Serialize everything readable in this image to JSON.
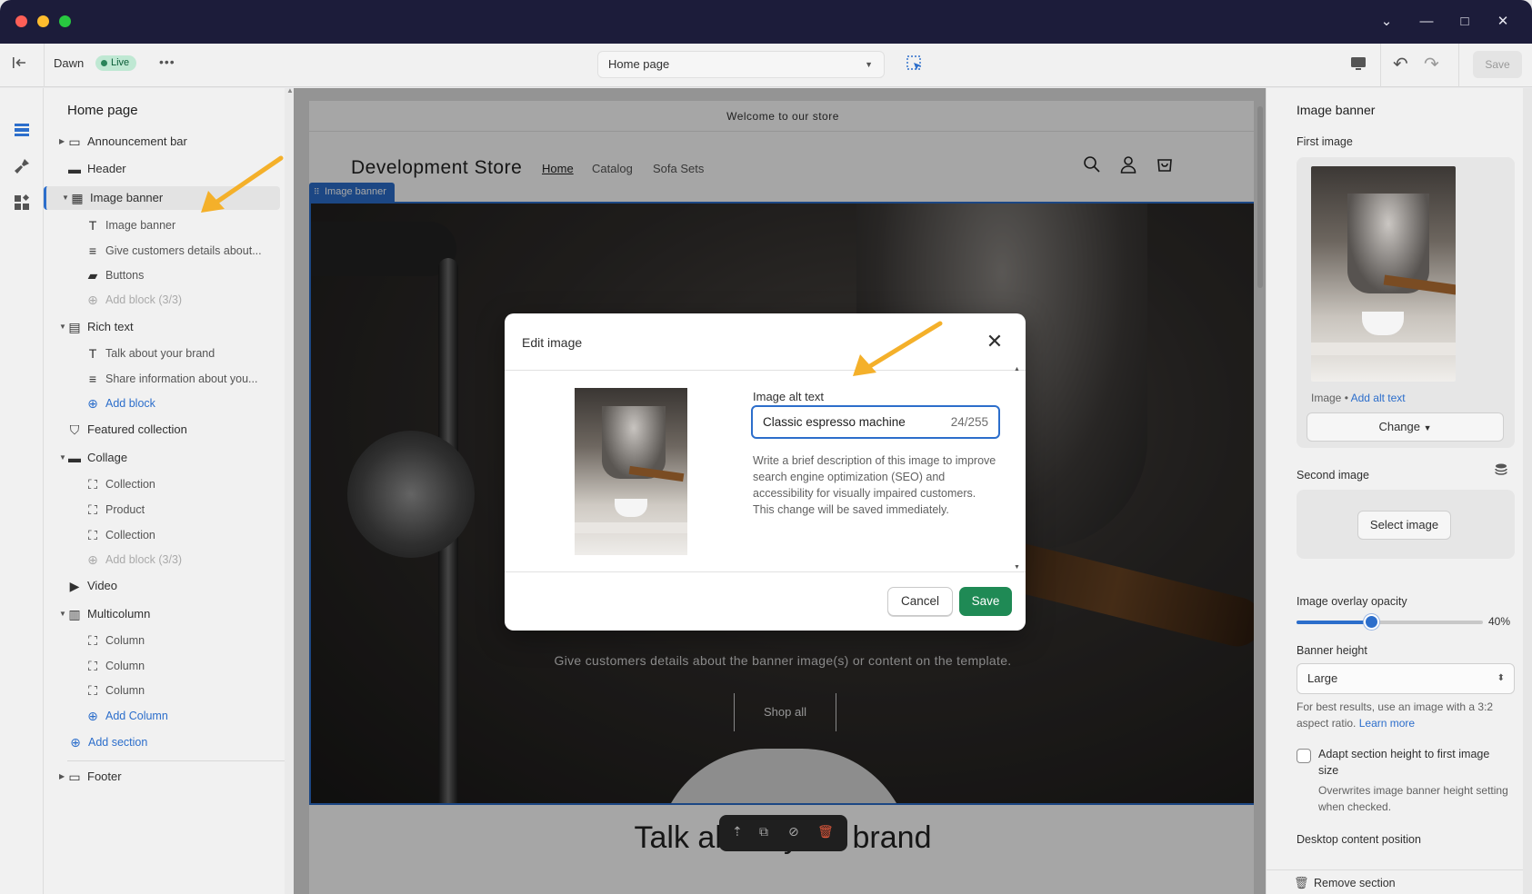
{
  "titlebar": {
    "controls": [
      "⌄",
      "—",
      "□",
      "✕"
    ]
  },
  "toolbar": {
    "theme_name": "Dawn",
    "live_badge": "Live",
    "more": "•••",
    "page_select": "Home page",
    "save_label": "Save"
  },
  "sidebar": {
    "title": "Home page",
    "items": [
      {
        "label": "Announcement bar",
        "icon": "layout-icon",
        "glyph": "▭",
        "level": 0,
        "toggle": "▶"
      },
      {
        "label": "Header",
        "icon": "layout-icon",
        "glyph": "▬",
        "level": 0,
        "toggle": ""
      },
      {
        "label": "Image banner",
        "icon": "image-icon",
        "glyph": "▦",
        "level": 0,
        "toggle": "▼",
        "active": true
      },
      {
        "label": "Image banner",
        "icon": "text-icon",
        "glyph": "T",
        "level": 1
      },
      {
        "label": "Give customers details about...",
        "icon": "paragraph-icon",
        "glyph": "≡",
        "level": 1
      },
      {
        "label": "Buttons",
        "icon": "button-icon",
        "glyph": "▰",
        "level": 1
      },
      {
        "label": "Add block (3/3)",
        "icon": "plus-circle-icon",
        "glyph": "⊕",
        "level": 1,
        "kind": "disabled"
      },
      {
        "label": "Rich text",
        "icon": "paragraph-icon",
        "glyph": "▤",
        "level": 0,
        "toggle": "▼"
      },
      {
        "label": "Talk about your brand",
        "icon": "text-icon",
        "glyph": "T",
        "level": 1
      },
      {
        "label": "Share information about you...",
        "icon": "paragraph-icon",
        "glyph": "≡",
        "level": 1
      },
      {
        "label": "Add block",
        "icon": "plus-circle-icon",
        "glyph": "⊕",
        "level": 1,
        "kind": "add"
      },
      {
        "label": "Featured collection",
        "icon": "tag-icon",
        "glyph": "⛉",
        "level": 0,
        "toggle": ""
      },
      {
        "label": "Collage",
        "icon": "layout-icon",
        "glyph": "▬",
        "level": 0,
        "toggle": "▼"
      },
      {
        "label": "Collection",
        "icon": "frame-icon",
        "glyph": "⛶",
        "level": 1
      },
      {
        "label": "Product",
        "icon": "frame-icon",
        "glyph": "⛶",
        "level": 1
      },
      {
        "label": "Collection",
        "icon": "frame-icon",
        "glyph": "⛶",
        "level": 1
      },
      {
        "label": "Add block (3/3)",
        "icon": "plus-circle-icon",
        "glyph": "⊕",
        "level": 1,
        "kind": "disabled"
      },
      {
        "label": "Video",
        "icon": "play-icon",
        "glyph": "▶",
        "level": 0,
        "toggle": ""
      },
      {
        "label": "Multicolumn",
        "icon": "columns-icon",
        "glyph": "▥",
        "level": 0,
        "toggle": "▼"
      },
      {
        "label": "Column",
        "icon": "frame-icon",
        "glyph": "⛶",
        "level": 1
      },
      {
        "label": "Column",
        "icon": "frame-icon",
        "glyph": "⛶",
        "level": 1
      },
      {
        "label": "Column",
        "icon": "frame-icon",
        "glyph": "⛶",
        "level": 1
      },
      {
        "label": "Add Column",
        "icon": "plus-circle-icon",
        "glyph": "⊕",
        "level": 1,
        "kind": "add"
      },
      {
        "label": "Add section",
        "icon": "plus-circle-icon",
        "glyph": "⊕",
        "level": 0,
        "kind": "add-section"
      },
      {
        "label": "Footer",
        "icon": "layout-icon",
        "glyph": "▭",
        "level": 0,
        "toggle": "▶"
      }
    ]
  },
  "store": {
    "announcement": "Welcome to our store",
    "name": "Development Store",
    "nav": [
      "Home",
      "Catalog",
      "Sofa Sets"
    ],
    "banner_tag": "Image banner",
    "banner_subtitle": "Give customers details about the banner image(s) or content on the template.",
    "banner_button": "Shop all",
    "rich_text_heading": "Talk about your brand"
  },
  "modal": {
    "title": "Edit image",
    "alt_label": "Image alt text",
    "alt_value": "Classic espresso machine",
    "alt_count": "24/255",
    "help": "Write a brief description of this image to improve search engine optimization (SEO) and accessibility for visually impaired customers. This change will be saved immediately.",
    "cancel": "Cancel",
    "save": "Save"
  },
  "settings": {
    "title": "Image banner",
    "first_image_label": "First image",
    "image_caption": "Image",
    "image_caption_sep": " • ",
    "add_alt_text": "Add alt text",
    "change_button": "Change",
    "second_image_label": "Second image",
    "select_image": "Select image",
    "overlay_label": "Image overlay opacity",
    "overlay_value": "40%",
    "overlay_fraction": 0.4,
    "height_label": "Banner height",
    "height_value": "Large",
    "height_help": "For best results, use an image with a 3:2 aspect ratio.",
    "learn_more": "Learn more",
    "adapt_label": "Adapt section height to first image size",
    "adapt_help": "Overwrites image banner height setting when checked.",
    "desktop_position_label": "Desktop content position",
    "remove_section": "Remove section"
  },
  "colors": {
    "accent": "#2c6ecb",
    "save_green": "#1f8a55",
    "arrow": "#f4b02a"
  }
}
